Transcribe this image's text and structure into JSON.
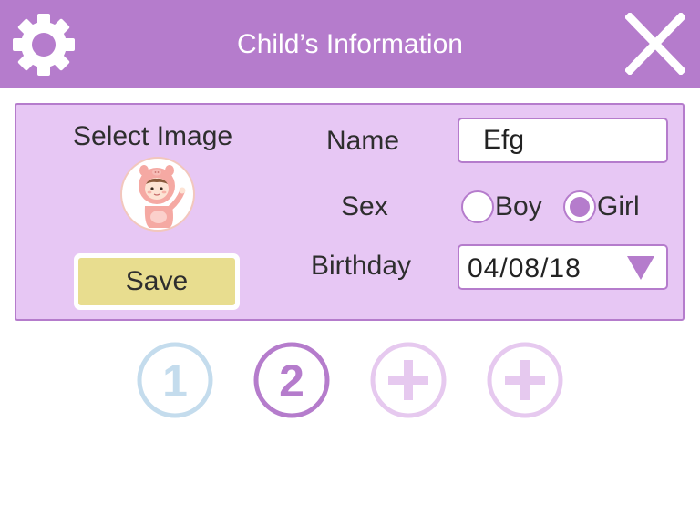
{
  "header": {
    "title": "Child’s Information",
    "settings_icon": "gear-icon",
    "close_icon": "close-icon",
    "background_color": "#b57ccc"
  },
  "form": {
    "select_image_label": "Select Image",
    "avatar_icon": "child-avatar-icon",
    "save_label": "Save",
    "name_label": "Name",
    "name_value": "Efg",
    "sex_label": "Sex",
    "sex_options": [
      {
        "label": "Boy",
        "selected": false
      },
      {
        "label": "Girl",
        "selected": true
      }
    ],
    "birthday_label": "Birthday",
    "birthday_value": "04/08/18",
    "birthday_dropdown_icon": "triangle-down-icon"
  },
  "profiles": [
    {
      "label": "1",
      "type": "number",
      "color": "#c4dced"
    },
    {
      "label": "2",
      "type": "number",
      "color": "#b57ccc",
      "active": true
    },
    {
      "label": "",
      "type": "add",
      "icon": "plus-icon",
      "color": "#e6c9ef"
    },
    {
      "label": "",
      "type": "add",
      "icon": "plus-icon",
      "color": "#e6c9ef"
    }
  ],
  "colors": {
    "accent": "#b57ccc",
    "panel": "#e7c7f4",
    "save_button": "#e8dd8f",
    "profile_inactive": "#c4dced",
    "profile_add": "#e6c9ef"
  }
}
